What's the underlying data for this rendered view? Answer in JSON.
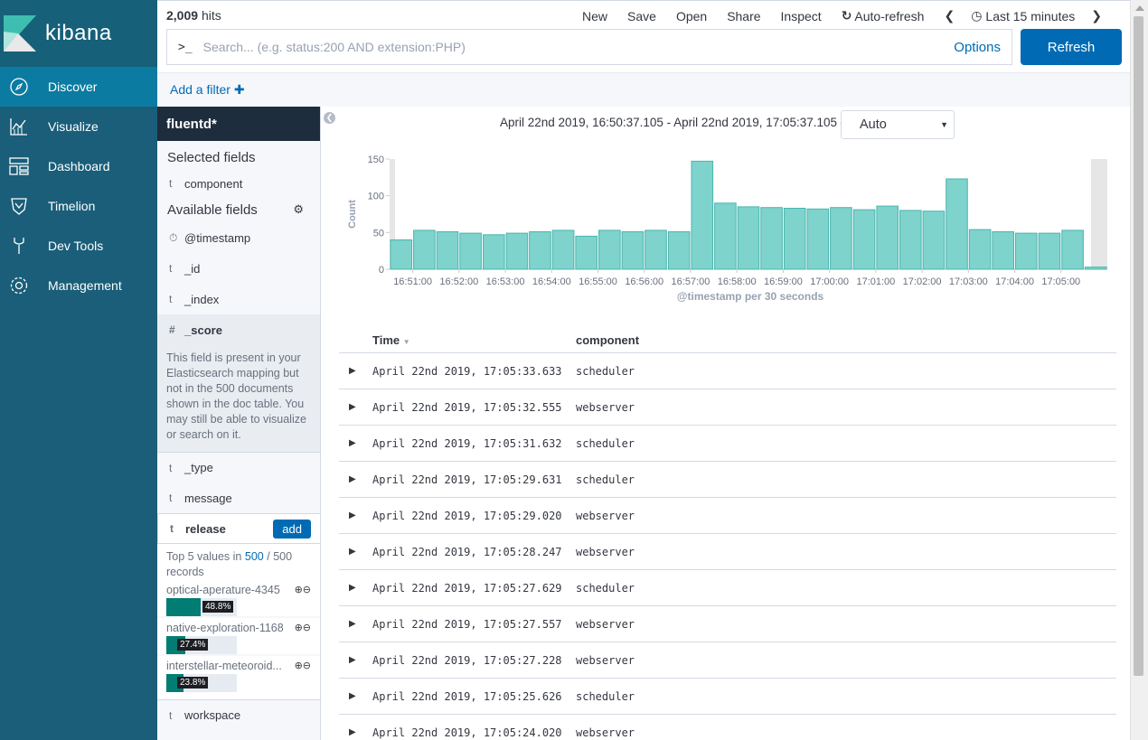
{
  "nav": {
    "brand": "kibana",
    "items": [
      {
        "label": "Discover",
        "icon": "compass-icon",
        "active": true
      },
      {
        "label": "Visualize",
        "icon": "chart-icon"
      },
      {
        "label": "Dashboard",
        "icon": "dashboard-icon"
      },
      {
        "label": "Timelion",
        "icon": "timelion-icon"
      },
      {
        "label": "Dev Tools",
        "icon": "wrench-icon"
      },
      {
        "label": "Management",
        "icon": "gear-icon"
      }
    ]
  },
  "topbar": {
    "hits_count": "2,009",
    "hits_label": "hits",
    "menu": {
      "new": "New",
      "save": "Save",
      "open": "Open",
      "share": "Share",
      "inspect": "Inspect",
      "autorefresh": "Auto-refresh",
      "timepicker": "Last 15 minutes"
    },
    "search_prompt": ">_",
    "search_placeholder": "Search... (e.g. status:200 AND extension:PHP)",
    "options": "Options",
    "refresh": "Refresh"
  },
  "filterbar": {
    "add_filter": "Add a filter"
  },
  "sidebar": {
    "index_pattern": "fluentd*",
    "selected_heading": "Selected fields",
    "selected": [
      {
        "type": "t",
        "name": "component"
      }
    ],
    "available_heading": "Available fields",
    "fields": {
      "timestamp": {
        "type": "⏱",
        "name": "@timestamp"
      },
      "id": {
        "type": "t",
        "name": "_id"
      },
      "index": {
        "type": "t",
        "name": "_index"
      },
      "score": {
        "type": "#",
        "name": "_score"
      },
      "type": {
        "type": "t",
        "name": "_type"
      },
      "message": {
        "type": "t",
        "name": "message"
      },
      "release": {
        "type": "t",
        "name": "release"
      },
      "workspace": {
        "type": "t",
        "name": "workspace"
      }
    },
    "score_note": "This field is present in your Elasticsearch mapping but not in the 500 documents shown in the doc table. You may still be able to visualize or search on it.",
    "add_button": "add",
    "top5": {
      "prefix": "Top 5 values in",
      "count": "500",
      "sep": "/",
      "total": "500",
      "suffix": "records"
    },
    "values": [
      {
        "label": "optical-aperature-4345",
        "pct": 48.8,
        "pct_label": "48.8%"
      },
      {
        "label": "native-exploration-1168",
        "pct": 27.4,
        "pct_label": "27.4%"
      },
      {
        "label": "interstellar-meteoroid...",
        "pct": 23.8,
        "pct_label": "23.8%"
      }
    ]
  },
  "main": {
    "time_range": "April 22nd 2019, 16:50:37.105 - April 22nd 2019, 17:05:37.105 —",
    "interval": "Auto"
  },
  "chart_data": {
    "type": "bar",
    "xlabel": "@timestamp per 30 seconds",
    "ylabel": "Count",
    "ylim": [
      0,
      150
    ],
    "yticks": [
      0,
      50,
      100,
      150
    ],
    "categories": [
      "16:50:30",
      "16:51:00",
      "16:51:30",
      "16:52:00",
      "16:52:30",
      "16:53:00",
      "16:53:30",
      "16:54:00",
      "16:54:30",
      "16:55:00",
      "16:55:30",
      "16:56:00",
      "16:56:30",
      "16:57:00",
      "16:57:30",
      "16:58:00",
      "16:58:30",
      "16:59:00",
      "16:59:30",
      "17:00:00",
      "17:00:30",
      "17:01:00",
      "17:01:30",
      "17:02:00",
      "17:02:30",
      "17:03:00",
      "17:03:30",
      "17:04:00",
      "17:04:30",
      "17:05:00",
      "17:05:30"
    ],
    "values": [
      40,
      53,
      51,
      49,
      47,
      49,
      51,
      53,
      45,
      53,
      51,
      53,
      51,
      147,
      90,
      85,
      84,
      83,
      82,
      84,
      81,
      86,
      80,
      79,
      123,
      54,
      51,
      49,
      49,
      53,
      3
    ],
    "xtick_labels": [
      "16:51:00",
      "16:52:00",
      "16:53:00",
      "16:54:00",
      "16:55:00",
      "16:56:00",
      "16:57:00",
      "16:58:00",
      "16:59:00",
      "17:00:00",
      "17:01:00",
      "17:02:00",
      "17:03:00",
      "17:04:00",
      "17:05:00"
    ],
    "bar_color": "#7ed3cc",
    "bar_stroke": "#4bb5ad"
  },
  "doctable": {
    "headers": {
      "time": "Time",
      "component": "component"
    },
    "rows": [
      {
        "time": "April 22nd 2019, 17:05:33.633",
        "component": "scheduler"
      },
      {
        "time": "April 22nd 2019, 17:05:32.555",
        "component": "webserver"
      },
      {
        "time": "April 22nd 2019, 17:05:31.632",
        "component": "scheduler"
      },
      {
        "time": "April 22nd 2019, 17:05:29.631",
        "component": "scheduler"
      },
      {
        "time": "April 22nd 2019, 17:05:29.020",
        "component": "webserver"
      },
      {
        "time": "April 22nd 2019, 17:05:28.247",
        "component": "webserver"
      },
      {
        "time": "April 22nd 2019, 17:05:27.629",
        "component": "scheduler"
      },
      {
        "time": "April 22nd 2019, 17:05:27.557",
        "component": "webserver"
      },
      {
        "time": "April 22nd 2019, 17:05:27.228",
        "component": "webserver"
      },
      {
        "time": "April 22nd 2019, 17:05:25.626",
        "component": "scheduler"
      },
      {
        "time": "April 22nd 2019, 17:05:24.020",
        "component": "webserver"
      }
    ]
  }
}
